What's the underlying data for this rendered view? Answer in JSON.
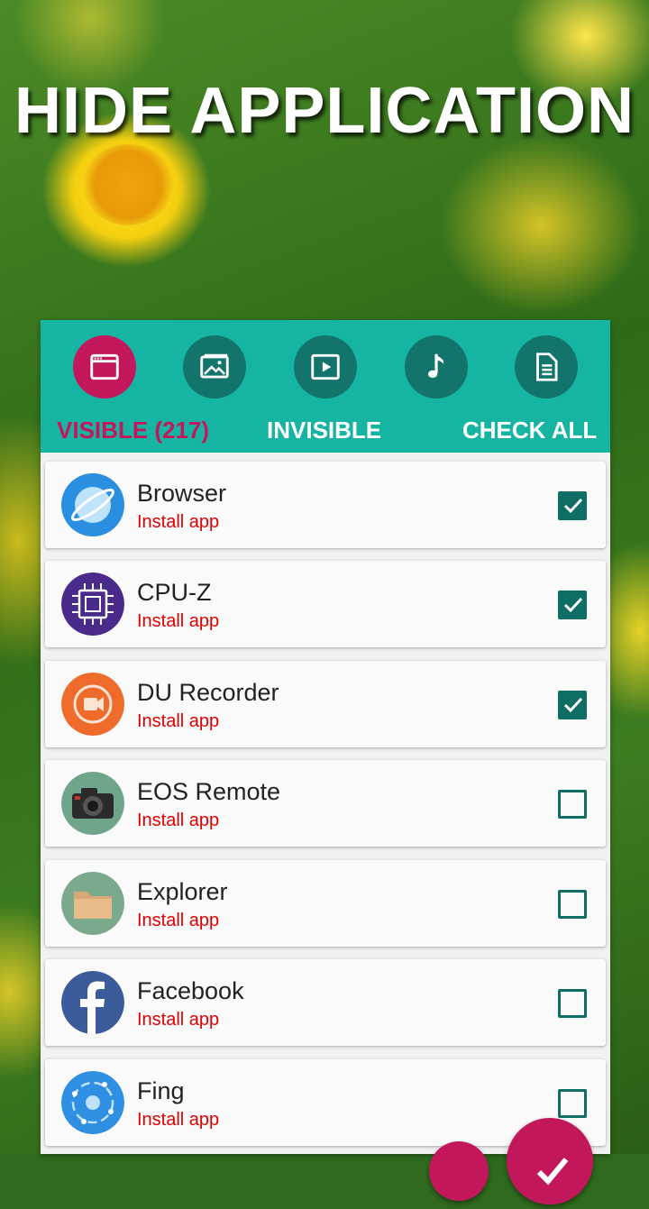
{
  "title": "HIDE APPLICATION",
  "colors": {
    "header": "#16b5a3",
    "category_button": "#12746b",
    "accent": "#c2185b",
    "checkbox": "#0e6e63",
    "status_text": "#e00000"
  },
  "categories": [
    {
      "icon": "app-window-icon",
      "active": true
    },
    {
      "icon": "image-icon",
      "active": false
    },
    {
      "icon": "video-play-icon",
      "active": false
    },
    {
      "icon": "music-note-icon",
      "active": false
    },
    {
      "icon": "document-icon",
      "active": false
    }
  ],
  "tabs": {
    "visible": "VISIBLE (217)",
    "invisible": "INVISIBLE",
    "check_all": "CHECK ALL"
  },
  "apps": [
    {
      "name": "Browser",
      "status": "Install app",
      "icon": "browser-icon",
      "checked": true
    },
    {
      "name": "CPU-Z",
      "status": "Install app",
      "icon": "cpu-z-icon",
      "checked": true
    },
    {
      "name": "DU Recorder",
      "status": "Install app",
      "icon": "du-recorder-icon",
      "checked": true
    },
    {
      "name": "EOS Remote",
      "status": "Install app",
      "icon": "eos-remote-icon",
      "checked": false
    },
    {
      "name": "Explorer",
      "status": "Install app",
      "icon": "explorer-icon",
      "checked": false
    },
    {
      "name": "Facebook",
      "status": "Install app",
      "icon": "facebook-icon",
      "checked": false
    },
    {
      "name": "Fing",
      "status": "Install app",
      "icon": "fing-icon",
      "checked": false
    }
  ],
  "fab": {
    "icon": "checkmark-icon"
  }
}
